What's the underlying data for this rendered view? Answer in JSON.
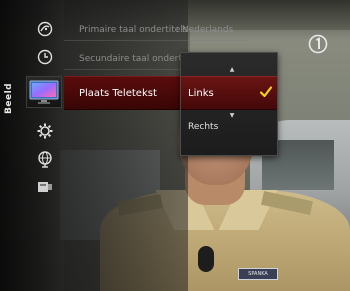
{
  "menu": {
    "section_label": "Beeld",
    "rows": [
      {
        "label": "Primaire taal ondertitels",
        "value": ": Nederlands"
      },
      {
        "label": "Secundaire taal ondertitels",
        "value": ""
      }
    ],
    "selected_label": "Plaats Teletekst"
  },
  "popup": {
    "options": [
      {
        "label": "Links",
        "selected": true
      },
      {
        "label": "Rechts",
        "selected": false
      }
    ],
    "up_arrow": "▲",
    "down_arrow": "▼"
  },
  "background": {
    "badge_text": "SPANKA"
  },
  "colors": {
    "selection": "#5a0c0c",
    "check": "#f2d21a"
  },
  "icons": {
    "rail": [
      "satellite-dish-icon",
      "clock-icon",
      "tv-picture-icon",
      "gear-icon",
      "globe-icon",
      "storage-icon"
    ],
    "corner": "channel-one-logo-icon"
  }
}
